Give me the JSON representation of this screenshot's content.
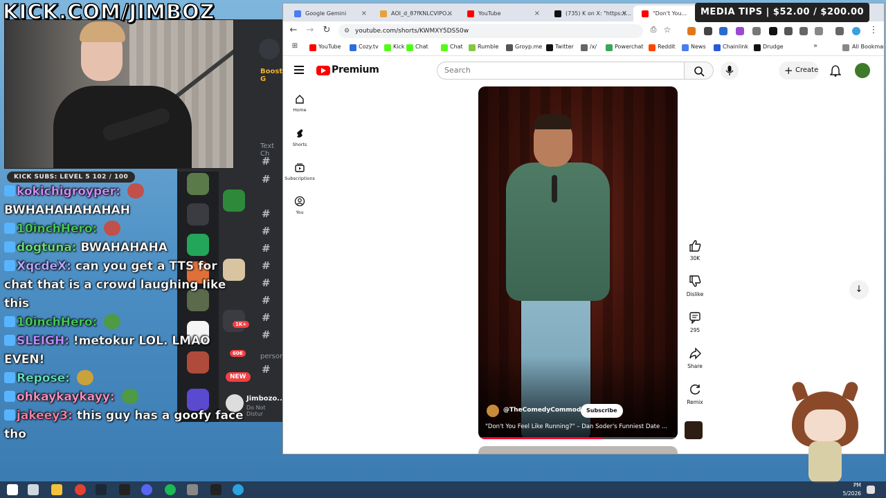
{
  "stream": {
    "banner": "KICK.COM/JIMBOZ",
    "subs_pill": "KICK SUBS: LEVEL 5 102 / 100",
    "media_tips": "MEDIA TIPS | $52.00 / $200.00"
  },
  "chat": [
    {
      "user": "kokichigroyper:",
      "user_color": "#d48cff",
      "text": ""
    },
    {
      "user": "",
      "user_color": "#ffffff",
      "text": "BWHAHAHAHAHAH"
    },
    {
      "user": "10inchHero:",
      "user_color": "#44cc55",
      "text": ""
    },
    {
      "user": "dogtuna:",
      "user_color": "#66e07a",
      "text": "BWAHAHAHA"
    },
    {
      "user": "XqcdeX:",
      "user_color": "#b9a7ff",
      "text": "can you get a TTS for chat that is a crowd laughing like this"
    },
    {
      "user": "10inchHero:",
      "user_color": "#44cc55",
      "text": ""
    },
    {
      "user": "SLEIGH:",
      "user_color": "#c08bff",
      "text": "!metokur LOL. LMAO EVEN!"
    },
    {
      "user": "Repose:",
      "user_color": "#5fe0c0",
      "text": ""
    },
    {
      "user": "ohkaykaykayy:",
      "user_color": "#ff8fbf",
      "text": ""
    },
    {
      "user": "jakeey3:",
      "user_color": "#ff7fa6",
      "text": "this guy has a goofy face tho"
    }
  ],
  "discord": {
    "text_channels_label": "Text Ch",
    "person_label": "person",
    "new_badge": "NEW",
    "user_name": "Jimbozo...",
    "user_status": "Do Not Distur",
    "boost_label": "Boost G",
    "count_badge": "606",
    "count_badge_2": "1K+"
  },
  "browser": {
    "tabs": [
      {
        "label": "Google Gemini",
        "color": "#4a7df0",
        "active": false
      },
      {
        "label": "AOI_d_87fKNLCVIPO...",
        "color": "#e8a23a",
        "active": false
      },
      {
        "label": "YouTube",
        "color": "#ff0000",
        "active": false
      },
      {
        "label": "(735) K on X: \"https://...",
        "color": "#111111",
        "active": false
      },
      {
        "label": "\"Don't You...",
        "color": "#ff0000",
        "active": true
      }
    ],
    "url": "youtube.com/shorts/KWMXY5DSS0w",
    "bookmarks": [
      {
        "label": "YouTube",
        "color": "#ff0000"
      },
      {
        "label": "Cozy.tv",
        "color": "#2d6be0"
      },
      {
        "label": "Kick",
        "color": "#53fc18"
      },
      {
        "label": "Chat",
        "color": "#53fc18"
      },
      {
        "label": "Chat",
        "color": "#53fc18"
      },
      {
        "label": "Rumble",
        "color": "#85c742"
      },
      {
        "label": "Groyp.me",
        "color": "#555555"
      },
      {
        "label": "Twitter",
        "color": "#111111"
      },
      {
        "label": "/x/",
        "color": "#666666"
      },
      {
        "label": "Powerchat",
        "color": "#3aa657"
      },
      {
        "label": "Reddit",
        "color": "#ff4500"
      },
      {
        "label": "News",
        "color": "#4a7df0"
      },
      {
        "label": "Chainlink",
        "color": "#2a5ada"
      },
      {
        "label": "Drudge",
        "color": "#111111"
      }
    ],
    "all_bookmarks": "All Bookmarks"
  },
  "youtube": {
    "logo_text": "Premium",
    "search_placeholder": "Search",
    "create_label": "Create",
    "sidebar": [
      {
        "label": "Home",
        "icon": "home-icon"
      },
      {
        "label": "Shorts",
        "icon": "shorts-icon"
      },
      {
        "label": "Subscriptions",
        "icon": "subscriptions-icon"
      },
      {
        "label": "You",
        "icon": "you-icon"
      }
    ],
    "short": {
      "channel": "@TheComedyCommodity",
      "subscribe": "Subscribe",
      "title": "\"Don't You Feel Like Running?\" – Dan Soder's Funniest Date ...",
      "progress": 0.62
    },
    "actions": [
      {
        "label": "30K",
        "icon": "like-icon"
      },
      {
        "label": "Dislike",
        "icon": "dislike-icon"
      },
      {
        "label": "295",
        "icon": "comments-icon"
      },
      {
        "label": "Share",
        "icon": "share-icon"
      },
      {
        "label": "Remix",
        "icon": "remix-icon"
      }
    ]
  },
  "taskbar": {
    "time": "PM",
    "date": "5/2026"
  }
}
